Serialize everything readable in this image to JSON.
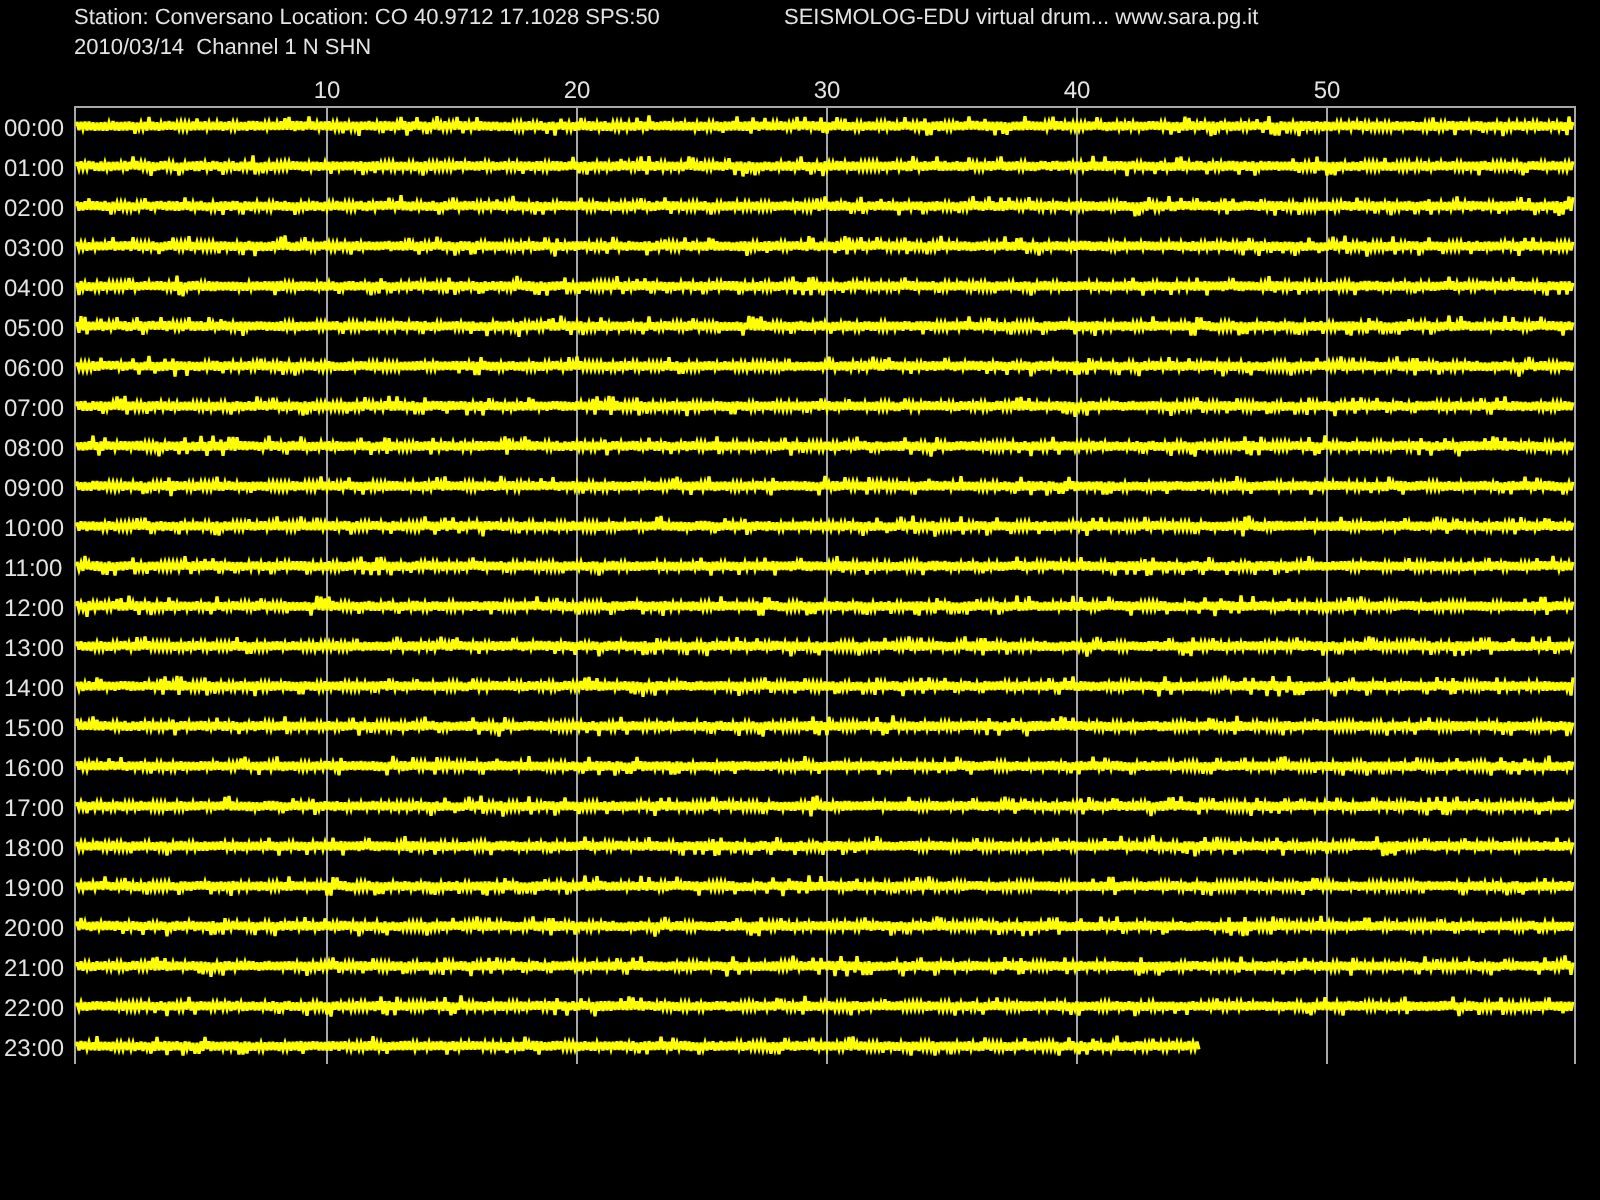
{
  "header": {
    "station_line": "Station: Conversano Location: CO 40.9712 17.1028 SPS:50",
    "title": "SEISMOLOG-EDU virtual drum... www.sara.pg.it",
    "date_line": "2010/03/14  Channel 1 N SHN"
  },
  "drum": {
    "minute_ticks": [
      "10",
      "20",
      "30",
      "40",
      "50"
    ],
    "rows": [
      {
        "label": "00:00",
        "level": 1
      },
      {
        "label": "01:00",
        "level": 1
      },
      {
        "label": "02:00",
        "level": 1
      },
      {
        "label": "03:00",
        "level": 1
      },
      {
        "label": "04:00",
        "level": 1
      },
      {
        "label": "05:00",
        "level": 1
      },
      {
        "label": "06:00",
        "level": 1
      },
      {
        "label": "07:00",
        "level": 1
      },
      {
        "label": "08:00",
        "level": 1
      },
      {
        "label": "09:00",
        "level": 1
      },
      {
        "label": "10:00",
        "level": 1
      },
      {
        "label": "11:00",
        "level": 1
      },
      {
        "label": "12:00",
        "level": 1
      },
      {
        "label": "13:00",
        "level": 1
      },
      {
        "label": "14:00",
        "level": 1
      },
      {
        "label": "15:00",
        "level": 1
      },
      {
        "label": "16:00",
        "level": 1
      },
      {
        "label": "17:00",
        "level": 1
      },
      {
        "label": "18:00",
        "level": 1
      },
      {
        "label": "19:00",
        "level": 1
      },
      {
        "label": "20:00",
        "level": 1
      },
      {
        "label": "21:00",
        "level": 1
      },
      {
        "label": "22:00",
        "level": 1
      },
      {
        "label": "23:00",
        "level": 0.75
      }
    ]
  }
}
